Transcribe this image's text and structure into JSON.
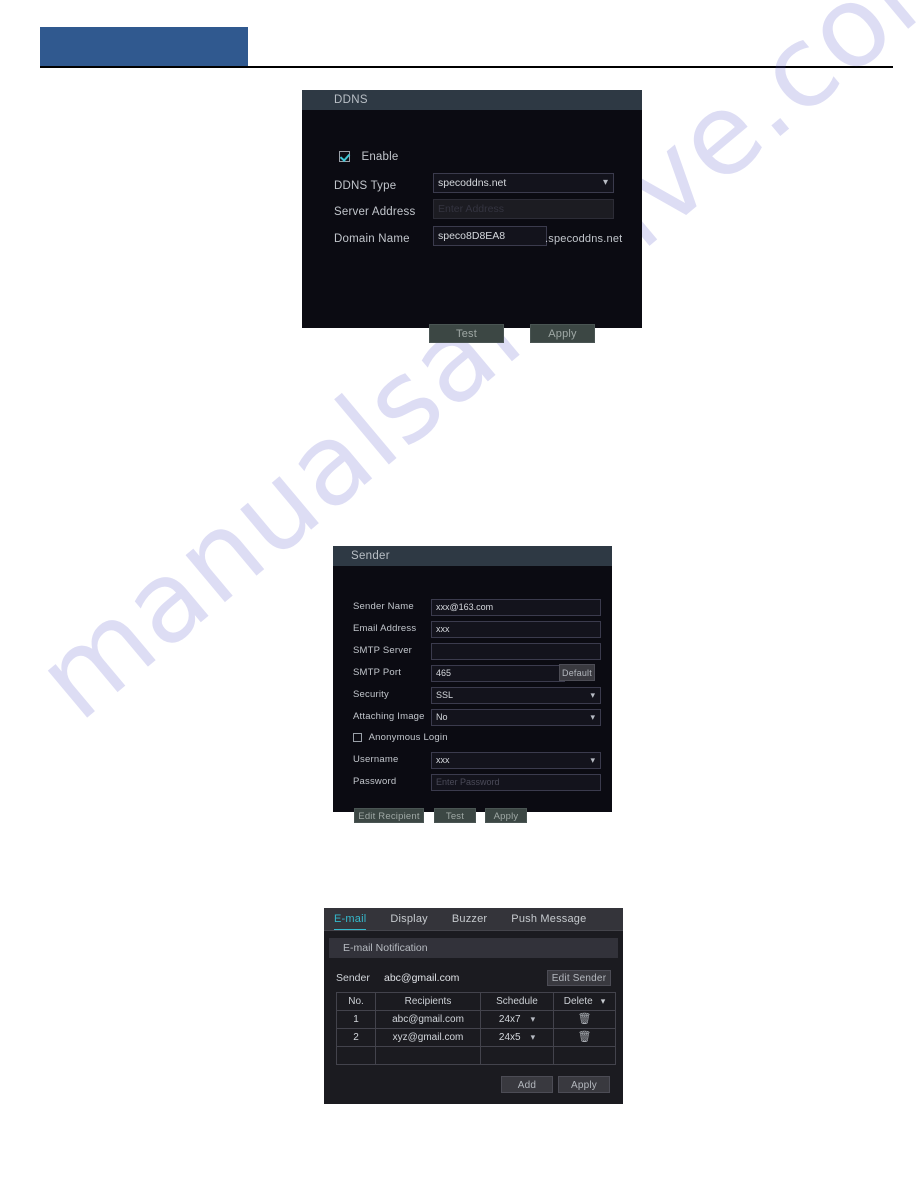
{
  "page": {
    "watermark": "manualsarchive.com",
    "header_accent_color": "#30598f"
  },
  "ddns_dialog": {
    "title": "DDNS",
    "enable": {
      "label": "Enable",
      "checked": true
    },
    "fields": {
      "ddns_type_label": "DDNS Type",
      "ddns_type_value": "specoddns.net",
      "server_address_label": "Server Address",
      "server_address_placeholder": "Enter Address",
      "domain_name_label": "Domain Name",
      "domain_name_value": "speco8D8EA8",
      "domain_suffix": ".specoddns.net"
    },
    "buttons": {
      "test": "Test",
      "apply": "Apply"
    }
  },
  "sender_dialog": {
    "title": "Sender",
    "rows": [
      {
        "label": "Sender Name",
        "value": "xxx@163.com",
        "type": "text"
      },
      {
        "label": "Email Address",
        "value": "xxx",
        "type": "text"
      },
      {
        "label": "SMTP Server",
        "value": "",
        "type": "text"
      },
      {
        "label": "SMTP Port",
        "value": "465",
        "type": "text"
      },
      {
        "label": "Security",
        "value": "SSL",
        "type": "select"
      },
      {
        "label": "Attaching Image",
        "value": "No",
        "type": "select"
      },
      {
        "label": "Username",
        "value": "xxx",
        "type": "select"
      },
      {
        "label": "Password",
        "value": "",
        "type": "password"
      }
    ],
    "default_button": "Default",
    "anonymous_login": {
      "label": "Anonymous Login",
      "checked": false
    },
    "password_placeholder": "Enter Password",
    "buttons": {
      "edit_recipient": "Edit Recipient",
      "test": "Test",
      "apply": "Apply"
    }
  },
  "notify_dialog": {
    "tabs": [
      {
        "label": "E-mail",
        "active": true
      },
      {
        "label": "Display",
        "active": false
      },
      {
        "label": "Buzzer",
        "active": false
      },
      {
        "label": "Push Message",
        "active": false
      }
    ],
    "section_title": "E-mail Notification",
    "sender_label": "Sender",
    "sender_value": "abc@gmail.com",
    "edit_sender_button": "Edit Sender",
    "columns": [
      "No.",
      "Recipients",
      "Schedule",
      "Delete"
    ],
    "rows": [
      {
        "no": "1",
        "recipient": "abc@gmail.com",
        "schedule": "24x7",
        "delete_icon": "trash-icon"
      },
      {
        "no": "2",
        "recipient": "xyz@gmail.com",
        "schedule": "24x5",
        "delete_icon": "trash-icon"
      }
    ],
    "buttons": {
      "add": "Add",
      "apply": "Apply"
    }
  }
}
